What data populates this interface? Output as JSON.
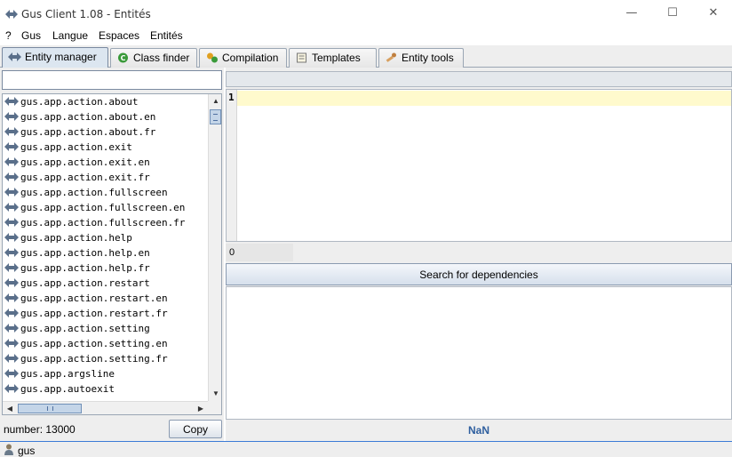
{
  "window": {
    "title": "Gus Client 1.08 - Entités",
    "app_icon": "gus-app-icon",
    "buttons": {
      "minimize": "—",
      "maximize": "☐",
      "close": "✕"
    }
  },
  "menu": [
    "?",
    "Gus",
    "Langue",
    "Espaces",
    "Entités"
  ],
  "tabs": [
    {
      "label": "Entity manager",
      "icon": "entity-icon",
      "active": true
    },
    {
      "label": "Class finder",
      "icon": "class-finder-icon",
      "active": false
    },
    {
      "label": "Compilation",
      "icon": "compilation-icon",
      "active": false
    },
    {
      "label": "Templates",
      "icon": "templates-icon",
      "active": false
    },
    {
      "label": "Entity tools",
      "icon": "entity-tools-icon",
      "active": false
    }
  ],
  "left": {
    "filter_value": "",
    "entities": [
      "gus.app.action.about",
      "gus.app.action.about.en",
      "gus.app.action.about.fr",
      "gus.app.action.exit",
      "gus.app.action.exit.en",
      "gus.app.action.exit.fr",
      "gus.app.action.fullscreen",
      "gus.app.action.fullscreen.en",
      "gus.app.action.fullscreen.fr",
      "gus.app.action.help",
      "gus.app.action.help.en",
      "gus.app.action.help.fr",
      "gus.app.action.restart",
      "gus.app.action.restart.en",
      "gus.app.action.restart.fr",
      "gus.app.action.setting",
      "gus.app.action.setting.en",
      "gus.app.action.setting.fr",
      "gus.app.argsline",
      "gus.app.autoexit"
    ],
    "count_label": "number: 13000",
    "copy_label": "Copy"
  },
  "right": {
    "editor_line_number": "1",
    "line_count": "0",
    "search_label": "Search for dependencies",
    "result_status": "NaN"
  },
  "status": {
    "user": "gus",
    "user_icon": "user-icon"
  },
  "colors": {
    "current_line": "#fffacd",
    "accent": "#2f5f9f",
    "status_border": "#3c7bd6"
  }
}
